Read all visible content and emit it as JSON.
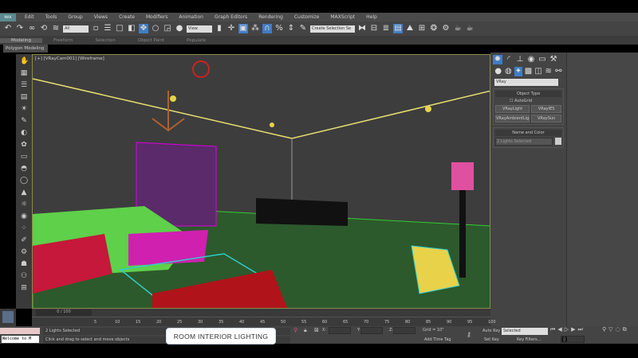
{
  "app": {
    "logo": "MAX"
  },
  "menu": [
    "Edit",
    "Tools",
    "Group",
    "Views",
    "Create",
    "Modifiers",
    "Animation",
    "Graph Editors",
    "Rendering",
    "Customize",
    "MAXScript",
    "Help"
  ],
  "toolbar": {
    "filter": "All",
    "ref_coord": "View",
    "selection_set": "Create Selection Se"
  },
  "ribbon": {
    "tabs": [
      "Modeling",
      "Freeform",
      "Selection",
      "Object Paint",
      "Populate"
    ],
    "active": "Modeling",
    "sub": "Polygon Modeling"
  },
  "viewport": {
    "label": "[+] [VRayCam001] [Wireframe]"
  },
  "panel": {
    "renderer": "VRay",
    "object_type": "Object Type",
    "autogrid": "AutoGrid",
    "buttons": [
      "VRayLight",
      "VRayIES",
      "VRayAmbientLig",
      "VRaySun"
    ],
    "name_color": "Name and Color",
    "name_value": "2 Lights Selected"
  },
  "timeline": {
    "frame": "0 / 100",
    "ticks": [
      "5",
      "10",
      "15",
      "20",
      "25",
      "30",
      "35",
      "40",
      "45",
      "50",
      "55",
      "60",
      "65",
      "70",
      "75",
      "80",
      "85",
      "90",
      "95",
      "100"
    ]
  },
  "status": {
    "selected": "2 Lights Selected",
    "prompt": "Click and drag to select and move objects",
    "listener": "Welcome to M",
    "x_label": "X:",
    "y_label": "Y:",
    "z_label": "Z:",
    "grid": "Grid = 10\"",
    "add_time_tag": "Add Time Tag",
    "auto_key": "Auto Key",
    "set_key": "Set Key",
    "key_mode": "Selected",
    "key_filters": "Key Filters...",
    "frame_field": "0"
  },
  "overlay": {
    "caption": "ROOM INTERIOR LIGHTING"
  }
}
